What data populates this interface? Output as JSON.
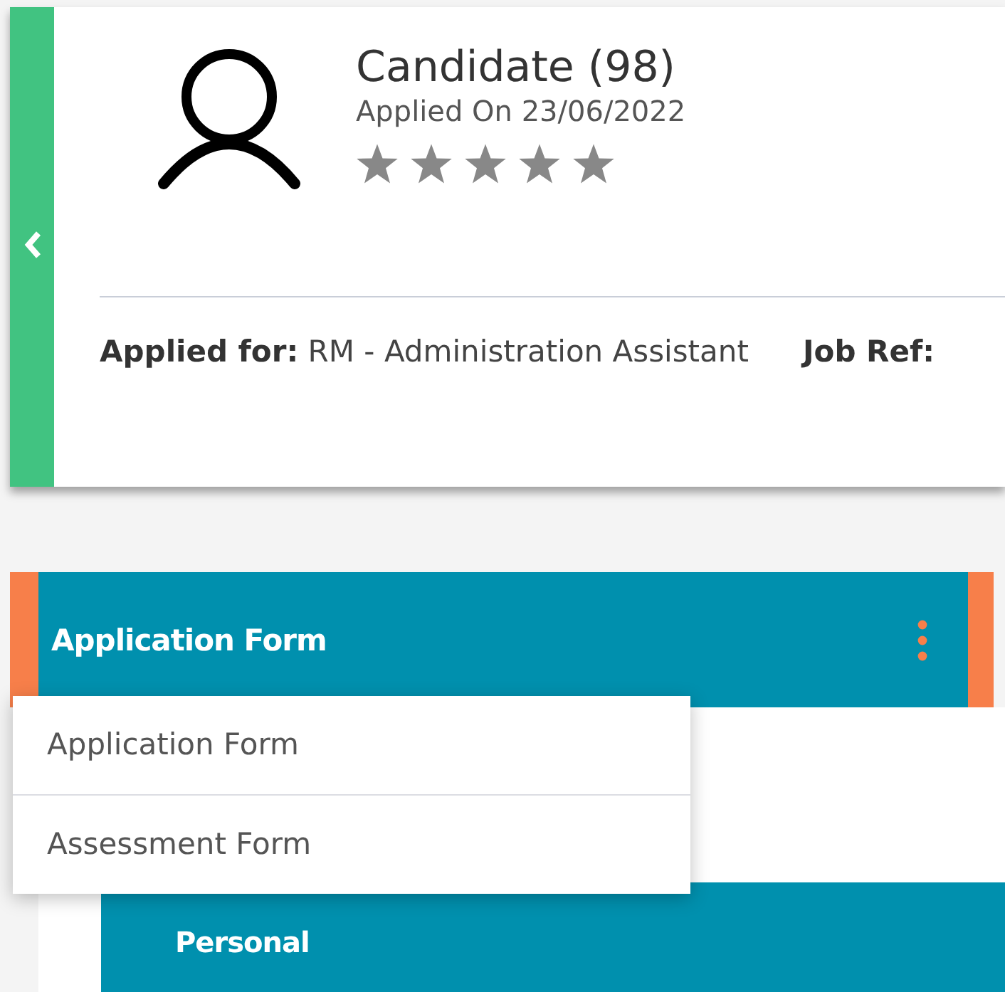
{
  "candidate": {
    "name": "Candidate (98)",
    "applied_on": "Applied On 23/06/2022",
    "stars": 5,
    "applied_for_label": "Applied for:",
    "applied_for_value": "RM - Administration Assistant",
    "job_ref_label": "Job Ref:"
  },
  "form_header": {
    "title": "Application Form"
  },
  "menu": [
    {
      "label": "Application Form"
    },
    {
      "label": "Assessment Form"
    }
  ],
  "section": {
    "title": "Personal"
  }
}
